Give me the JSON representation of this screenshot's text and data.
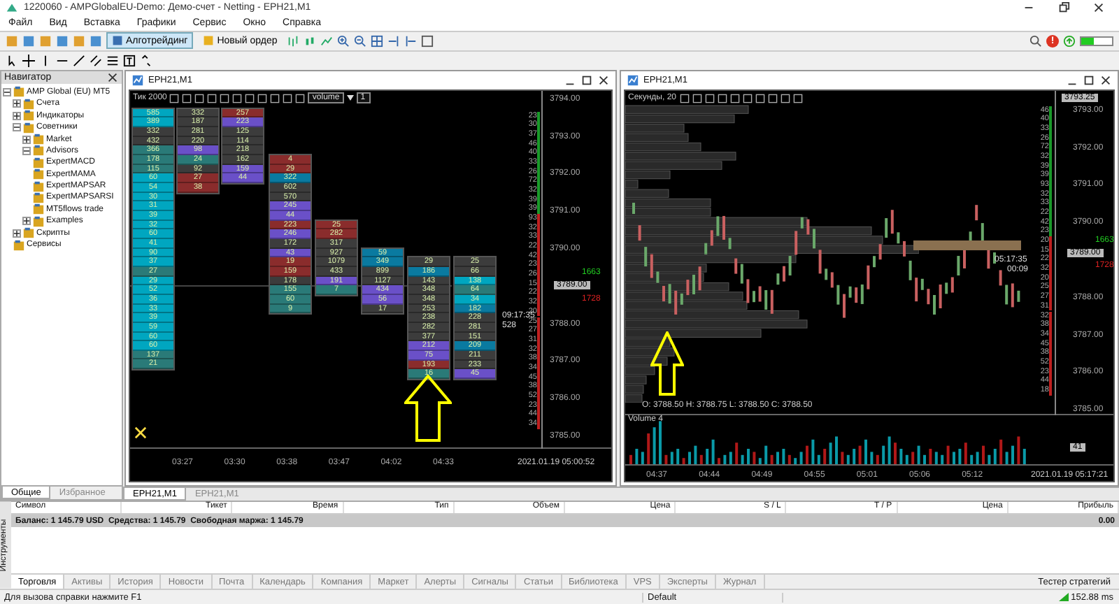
{
  "window": {
    "title": "1220060 - AMPGlobalEU-Demo: Демо-счет - Netting - EPH21,M1"
  },
  "menu": [
    "Файл",
    "Вид",
    "Вставка",
    "Графики",
    "Сервис",
    "Окно",
    "Справка"
  ],
  "toolbar": {
    "buttons": [
      {
        "label": "Алготрейдинг",
        "pressed": true
      },
      {
        "label": "Новый ордер",
        "pressed": false
      }
    ],
    "alert": "!"
  },
  "navigator": {
    "title": "Навигатор",
    "tree": [
      {
        "label": "AMP Global (EU) MT5",
        "expanded": true,
        "children": [
          {
            "label": "Счета",
            "expanded": false
          },
          {
            "label": "Индикаторы",
            "expanded": false
          },
          {
            "label": "Советники",
            "expanded": true,
            "children": [
              {
                "label": "Market",
                "expanded": false
              },
              {
                "label": "Advisors",
                "expanded": true,
                "children": [
                  {
                    "label": "ExpertMACD"
                  },
                  {
                    "label": "ExpertMAMA"
                  },
                  {
                    "label": "ExpertMAPSAR"
                  },
                  {
                    "label": "ExpertMAPSARSI"
                  },
                  {
                    "label": "MT5flows trade"
                  }
                ]
              },
              {
                "label": "Examples",
                "expanded": false
              }
            ]
          },
          {
            "label": "Скрипты",
            "expanded": false
          },
          {
            "label": "Сервисы"
          }
        ]
      }
    ],
    "tabs": [
      {
        "label": "Общие",
        "selected": true
      },
      {
        "label": "Избранное",
        "selected": false
      }
    ]
  },
  "charts": [
    {
      "kind": "cluster",
      "title": "EPH21,M1",
      "mode": "Тик 2000",
      "indicator": "volume",
      "count": "1",
      "clusters": [
        {
          "cells": [
            {
              "value": "585",
              "color": "#00a6c0"
            },
            {
              "value": "389",
              "color": "#00a6c0"
            },
            {
              "value": "332",
              "color": "#3c3c3c"
            },
            {
              "value": "432",
              "color": "#3c3c3c"
            },
            {
              "value": "366",
              "color": "#2a7a78"
            },
            {
              "value": "178",
              "color": "#2a7a78"
            },
            {
              "value": "115",
              "color": "#2a7a78"
            },
            {
              "value": "60",
              "color": "#00a6c0"
            },
            {
              "value": "54",
              "color": "#00a6c0"
            },
            {
              "value": "30",
              "color": "#00a6c0"
            },
            {
              "value": "31",
              "color": "#00a6c0"
            },
            {
              "value": "39",
              "color": "#00a6c0"
            },
            {
              "value": "32",
              "color": "#00a6c0"
            },
            {
              "value": "60",
              "color": "#00a6c0"
            },
            {
              "value": "41",
              "color": "#00a6c0"
            },
            {
              "value": "90",
              "color": "#00a6c0"
            },
            {
              "value": "37",
              "color": "#00a6c0"
            },
            {
              "value": "27",
              "color": "#2a7a78"
            },
            {
              "value": "29",
              "color": "#00a6c0"
            },
            {
              "value": "52",
              "color": "#00a6c0"
            },
            {
              "value": "36",
              "color": "#00a6c0"
            },
            {
              "value": "33",
              "color": "#00a6c0"
            },
            {
              "value": "39",
              "color": "#00a6c0"
            },
            {
              "value": "59",
              "color": "#00a6c0"
            },
            {
              "value": "60",
              "color": "#00a6c0"
            },
            {
              "value": "60",
              "color": "#00a6c0"
            },
            {
              "value": "137",
              "color": "#2a7a78"
            },
            {
              "value": "21",
              "color": "#2a7a78"
            }
          ]
        },
        {
          "cells": [
            {
              "value": "332",
              "color": "#3c3c3c"
            },
            {
              "value": "187",
              "color": "#3c3c3c"
            },
            {
              "value": "281",
              "color": "#3c3c3c"
            },
            {
              "value": "220",
              "color": "#3c3c3c"
            },
            {
              "value": "98",
              "color": "#6a50c8"
            },
            {
              "value": "24",
              "color": "#2a7a78"
            },
            {
              "value": "92",
              "color": "#3c3c3c"
            },
            {
              "value": "27",
              "color": "#8a2c2c"
            },
            {
              "value": "38",
              "color": "#8a2c2c"
            }
          ]
        },
        {
          "cells": [
            {
              "value": "257",
              "color": "#8a2c2c"
            },
            {
              "value": "223",
              "color": "#6a50c8"
            },
            {
              "value": "125",
              "color": "#3c3c3c"
            },
            {
              "value": "114",
              "color": "#3c3c3c"
            },
            {
              "value": "218",
              "color": "#3c3c3c"
            },
            {
              "value": "162",
              "color": "#3c3c3c"
            },
            {
              "value": "159",
              "color": "#6a50c8"
            },
            {
              "value": "44",
              "color": "#6a50c8"
            }
          ]
        },
        {
          "cells": [
            {
              "value": "4",
              "color": "#8a2c2c"
            },
            {
              "value": "29",
              "color": "#8a2c2c"
            },
            {
              "value": "322",
              "color": "#0a7aa0"
            },
            {
              "value": "602",
              "color": "#3c3c3c"
            },
            {
              "value": "570",
              "color": "#3c3c3c"
            },
            {
              "value": "245",
              "color": "#6a50c8"
            },
            {
              "value": "44",
              "color": "#6a50c8"
            },
            {
              "value": "223",
              "color": "#8a2c2c"
            },
            {
              "value": "246",
              "color": "#6a50c8"
            },
            {
              "value": "172",
              "color": "#3c3c3c"
            },
            {
              "value": "43",
              "color": "#6a50c8"
            },
            {
              "value": "19",
              "color": "#8a2c2c"
            },
            {
              "value": "159",
              "color": "#8a2c2c"
            },
            {
              "value": "178",
              "color": "#3c3c3c"
            },
            {
              "value": "155",
              "color": "#2a7a78"
            },
            {
              "value": "60",
              "color": "#2a7a78"
            },
            {
              "value": "9",
              "color": "#2a7a78"
            }
          ]
        },
        {
          "cells": [
            {
              "value": "25",
              "color": "#8a2c2c"
            },
            {
              "value": "282",
              "color": "#8a2c2c"
            },
            {
              "value": "317",
              "color": "#3c3c3c"
            },
            {
              "value": "927",
              "color": "#3c3c3c"
            },
            {
              "value": "1079",
              "color": "#3c3c3c"
            },
            {
              "value": "433",
              "color": "#3c3c3c"
            },
            {
              "value": "191",
              "color": "#6a50c8"
            },
            {
              "value": "7",
              "color": "#2a7a78"
            }
          ]
        },
        {
          "cells": [
            {
              "value": "59",
              "color": "#0a7aa0"
            },
            {
              "value": "349",
              "color": "#0a7aa0"
            },
            {
              "value": "899",
              "color": "#3c3c3c"
            },
            {
              "value": "1127",
              "color": "#3c3c3c"
            },
            {
              "value": "434",
              "color": "#6a50c8"
            },
            {
              "value": "56",
              "color": "#6a50c8"
            },
            {
              "value": "17",
              "color": "#3c3c3c"
            }
          ]
        },
        {
          "cells": [
            {
              "value": "29",
              "color": "#3c3c3c"
            },
            {
              "value": "186",
              "color": "#0a7aa0"
            },
            {
              "value": "143",
              "color": "#3c3c3c"
            },
            {
              "value": "348",
              "color": "#3c3c3c"
            },
            {
              "value": "348",
              "color": "#3c3c3c"
            },
            {
              "value": "253",
              "color": "#3c3c3c"
            },
            {
              "value": "238",
              "color": "#3c3c3c"
            },
            {
              "value": "282",
              "color": "#3c3c3c"
            },
            {
              "value": "377",
              "color": "#3c3c3c"
            },
            {
              "value": "212",
              "color": "#6a50c8"
            },
            {
              "value": "75",
              "color": "#6a50c8"
            },
            {
              "value": "193",
              "color": "#8a2c2c"
            },
            {
              "value": "16",
              "color": "#2a7a78"
            }
          ]
        },
        {
          "cells": [
            {
              "value": "25",
              "color": "#3c3c3c"
            },
            {
              "value": "66",
              "color": "#3c3c3c"
            },
            {
              "value": "138",
              "color": "#00a6c0"
            },
            {
              "value": "64",
              "color": "#2a7a78"
            },
            {
              "value": "34",
              "color": "#00a6c0"
            },
            {
              "value": "182",
              "color": "#0a7aa0"
            },
            {
              "value": "228",
              "color": "#3c3c3c"
            },
            {
              "value": "281",
              "color": "#3c3c3c"
            },
            {
              "value": "151",
              "color": "#3c3c3c"
            },
            {
              "value": "209",
              "color": "#0a7aa0"
            },
            {
              "value": "211",
              "color": "#3c3c3c"
            },
            {
              "value": "233",
              "color": "#3c3c3c"
            },
            {
              "value": "45",
              "color": "#6a50c8"
            }
          ]
        }
      ],
      "price_labels": [
        "3794.00",
        "3793.00",
        "3792.00",
        "3791.00",
        "3790.00",
        "3788.00",
        "3787.00",
        "3786.00",
        "3785.00"
      ],
      "level_values": [
        "23",
        "30",
        "37",
        "46",
        "40",
        "33",
        "26",
        "72",
        "32",
        "39",
        "39",
        "93",
        "32",
        "33",
        "22",
        "42",
        "23",
        "26",
        "15",
        "22",
        "32",
        "20",
        "25",
        "27",
        "31",
        "32",
        "38",
        "34",
        "45",
        "38",
        "52",
        "23",
        "44",
        "34"
      ],
      "price_flag": "3789.00",
      "ask_volume": "1663",
      "bid_volume": "1728",
      "timer": "09:17:35",
      "timer_sub": "528",
      "time_labels": [
        "03:27",
        "03:30",
        "03:38",
        "03:47",
        "04:02",
        "04:33"
      ],
      "date_label": "2021.01.19 05:00:52"
    },
    {
      "kind": "candles",
      "title": "EPH21,M1",
      "mode": "Секунды, 20",
      "top_price": "3793.25",
      "price_labels": [
        "3793.00",
        "3792.00",
        "3791.00",
        "3790.00",
        "3788.00",
        "3787.00",
        "3786.00",
        "3785.00"
      ],
      "level_values": [
        "46",
        "40",
        "33",
        "26",
        "72",
        "32",
        "39",
        "39",
        "93",
        "32",
        "33",
        "22",
        "42",
        "23",
        "20",
        "15",
        "22",
        "32",
        "20",
        "25",
        "27",
        "31",
        "32",
        "38",
        "34",
        "45",
        "38",
        "52",
        "23",
        "44",
        "18"
      ],
      "price_flag": "3789.00",
      "ask_volume": "1663",
      "bid_volume": "1728",
      "timer": "05:17:35",
      "timer_sub": "00:09",
      "ohlc": "O: 3788.50  H: 3788.75  L: 3788.50  C: 3788.50",
      "volume_title": "Volume 4",
      "volume_value": "41",
      "time_labels": [
        "04:37",
        "04:44",
        "04:49",
        "04:55",
        "05:01",
        "05:06",
        "05:12"
      ],
      "date_label": "2021.01.19 05:17:21"
    }
  ],
  "chart_tabs": [
    {
      "label": "EPH21,M1",
      "selected": true
    },
    {
      "label": "EPH21,M1",
      "selected": false
    }
  ],
  "terminal": {
    "side_label": "Инструменты",
    "columns": [
      "Символ",
      "Тикет",
      "Время",
      "Тип",
      "Объем",
      "Цена",
      "S / L",
      "T / P",
      "Цена",
      "Прибыль"
    ],
    "balance": "Баланс: 1 145.79 USD  Средства: 1 145.79  Свободная маржа: 1 145.79",
    "profit": "0.00",
    "tabs": [
      {
        "label": "Торговля",
        "selected": true
      },
      {
        "label": "Активы",
        "selected": false
      },
      {
        "label": "История",
        "selected": false
      },
      {
        "label": "Новости",
        "selected": false
      },
      {
        "label": "Почта",
        "selected": false
      },
      {
        "label": "Календарь",
        "selected": false
      },
      {
        "label": "Компания",
        "selected": false
      },
      {
        "label": "Маркет",
        "selected": false
      },
      {
        "label": "Алерты",
        "selected": false
      },
      {
        "label": "Сигналы",
        "selected": false
      },
      {
        "label": "Статьи",
        "selected": false
      },
      {
        "label": "Библиотека",
        "selected": false
      },
      {
        "label": "VPS",
        "selected": false
      },
      {
        "label": "Эксперты",
        "selected": false
      },
      {
        "label": "Журнал",
        "selected": false
      }
    ],
    "tester": "Тестер стратегий"
  },
  "status_bar": {
    "help": "Для вызова справки нажмите F1",
    "profile": "Default",
    "ping": "152.88 ms"
  }
}
